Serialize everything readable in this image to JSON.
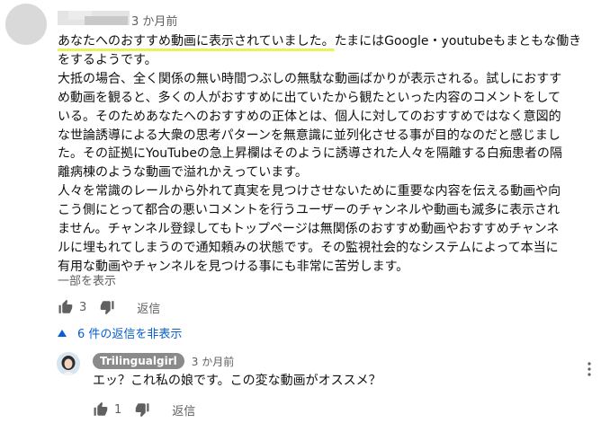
{
  "comment": {
    "time": "3 か月前",
    "highlight": "あなたへのおすすめ動画に表示されていました。",
    "lines": [
      "たまにはGoogle・youtubeもまともな働き",
      "をするようです。",
      "大抵の場合、全く関係の無い時間つぶしの無駄な動画ばかりが表示される。試しにおすす",
      "め動画を観ると、多くの人がおすすめに出ていたから観たといった内容のコメントをして",
      "いる。そのためあなたへのおすすめの正体とは、個人に対してのおすすめではなく意図的",
      "な世論誘導による大衆の思考パターンを無意識に並列化させる事が目的なのだと感じまし",
      "た。その証拠にYouTubeの急上昇欄はそのように誘導された人々を隔離する白痴患者の隔",
      "離病棟のような動画で溢れかえっています。",
      "人々を常識のレールから外れて真実を見つけさせないために重要な内容を伝える動画や向",
      "こう側にとって都合の悪いコメントを行うユーザーのチャンネルや動画も滅多に表示され",
      "ません。チャンネル登録してもトップページは無関係のおすすめ動画やおすすめチャンネ",
      "ルに埋もれてしまうので通知頼みの状態です。その監視社会的なシステムによって本当に",
      "有用な動画やチャンネルを見つける事にも非常に苦労します。"
    ],
    "show_less": "一部を表示",
    "likes": "3",
    "reply_label": "返信",
    "icons": [
      "thumbs-up-icon",
      "thumbs-down-icon"
    ]
  },
  "replies_toggle": "6 件の返信を非表示",
  "reply": {
    "author": "Trilingualgirl",
    "time": "3 か月前",
    "text": "エッ？これ私の娘です。この変な動画がオススメ？",
    "likes": "1",
    "reply_label": "返信"
  },
  "colors": {
    "link": "#065fd4",
    "muted": "#606060",
    "highlight": "#e8f35a"
  }
}
